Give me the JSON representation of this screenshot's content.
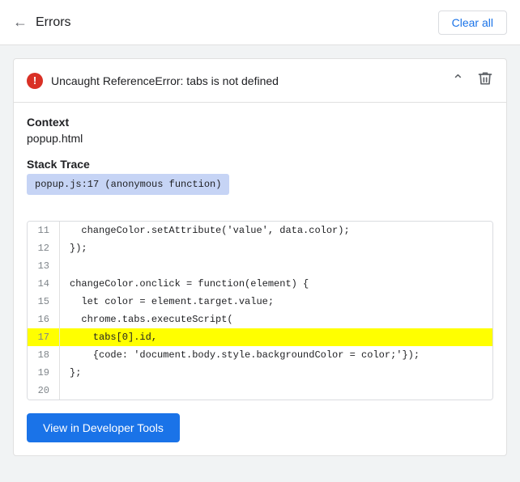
{
  "header": {
    "back_label": "←",
    "title": "Errors",
    "clear_all_label": "Clear all"
  },
  "error": {
    "icon_label": "!",
    "message": "Uncaught ReferenceError: tabs is not defined",
    "context_label": "Context",
    "context_value": "popup.html",
    "stack_trace_label": "Stack Trace",
    "stack_trace_pill": "popup.js:17 (anonymous function)",
    "code_lines": [
      {
        "number": "11",
        "content": "  changeColor.setAttribute('value', data.color);",
        "highlighted": false
      },
      {
        "number": "12",
        "content": "});",
        "highlighted": false
      },
      {
        "number": "13",
        "content": "",
        "highlighted": false
      },
      {
        "number": "14",
        "content": "changeColor.onclick = function(element) {",
        "highlighted": false
      },
      {
        "number": "15",
        "content": "  let color = element.target.value;",
        "highlighted": false
      },
      {
        "number": "16",
        "content": "  chrome.tabs.executeScript(",
        "highlighted": false
      },
      {
        "number": "17",
        "content": "    tabs[0].id,",
        "highlighted": true
      },
      {
        "number": "18",
        "content": "    {code: 'document.body.style.backgroundColor = color;'});",
        "highlighted": false
      },
      {
        "number": "19",
        "content": "};",
        "highlighted": false
      },
      {
        "number": "20",
        "content": "",
        "highlighted": false
      }
    ]
  },
  "footer": {
    "dev_tools_label": "View in Developer Tools"
  }
}
